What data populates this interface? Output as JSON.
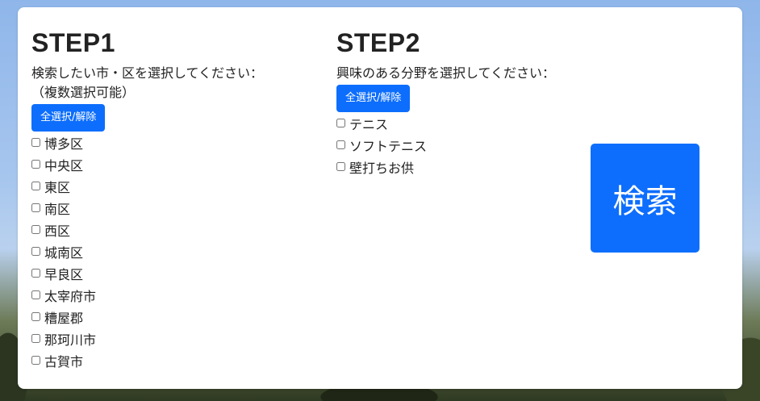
{
  "step1": {
    "title": "STEP1",
    "prompt_line1": "検索したい市・区を選択してください：",
    "prompt_line2": "（複数選択可能）",
    "toggle_all_label": "全選択/解除",
    "options": [
      "博多区",
      "中央区",
      "東区",
      "南区",
      "西区",
      "城南区",
      "早良区",
      "太宰府市",
      "糟屋郡",
      "那珂川市",
      "古賀市"
    ]
  },
  "step2": {
    "title": "STEP2",
    "prompt": "興味のある分野を選択してください：",
    "toggle_all_label": "全選択/解除",
    "options": [
      "テニス",
      "ソフトテニス",
      "壁打ちお供"
    ]
  },
  "search": {
    "label": "検索"
  },
  "colors": {
    "accent": "#0d6efd"
  }
}
